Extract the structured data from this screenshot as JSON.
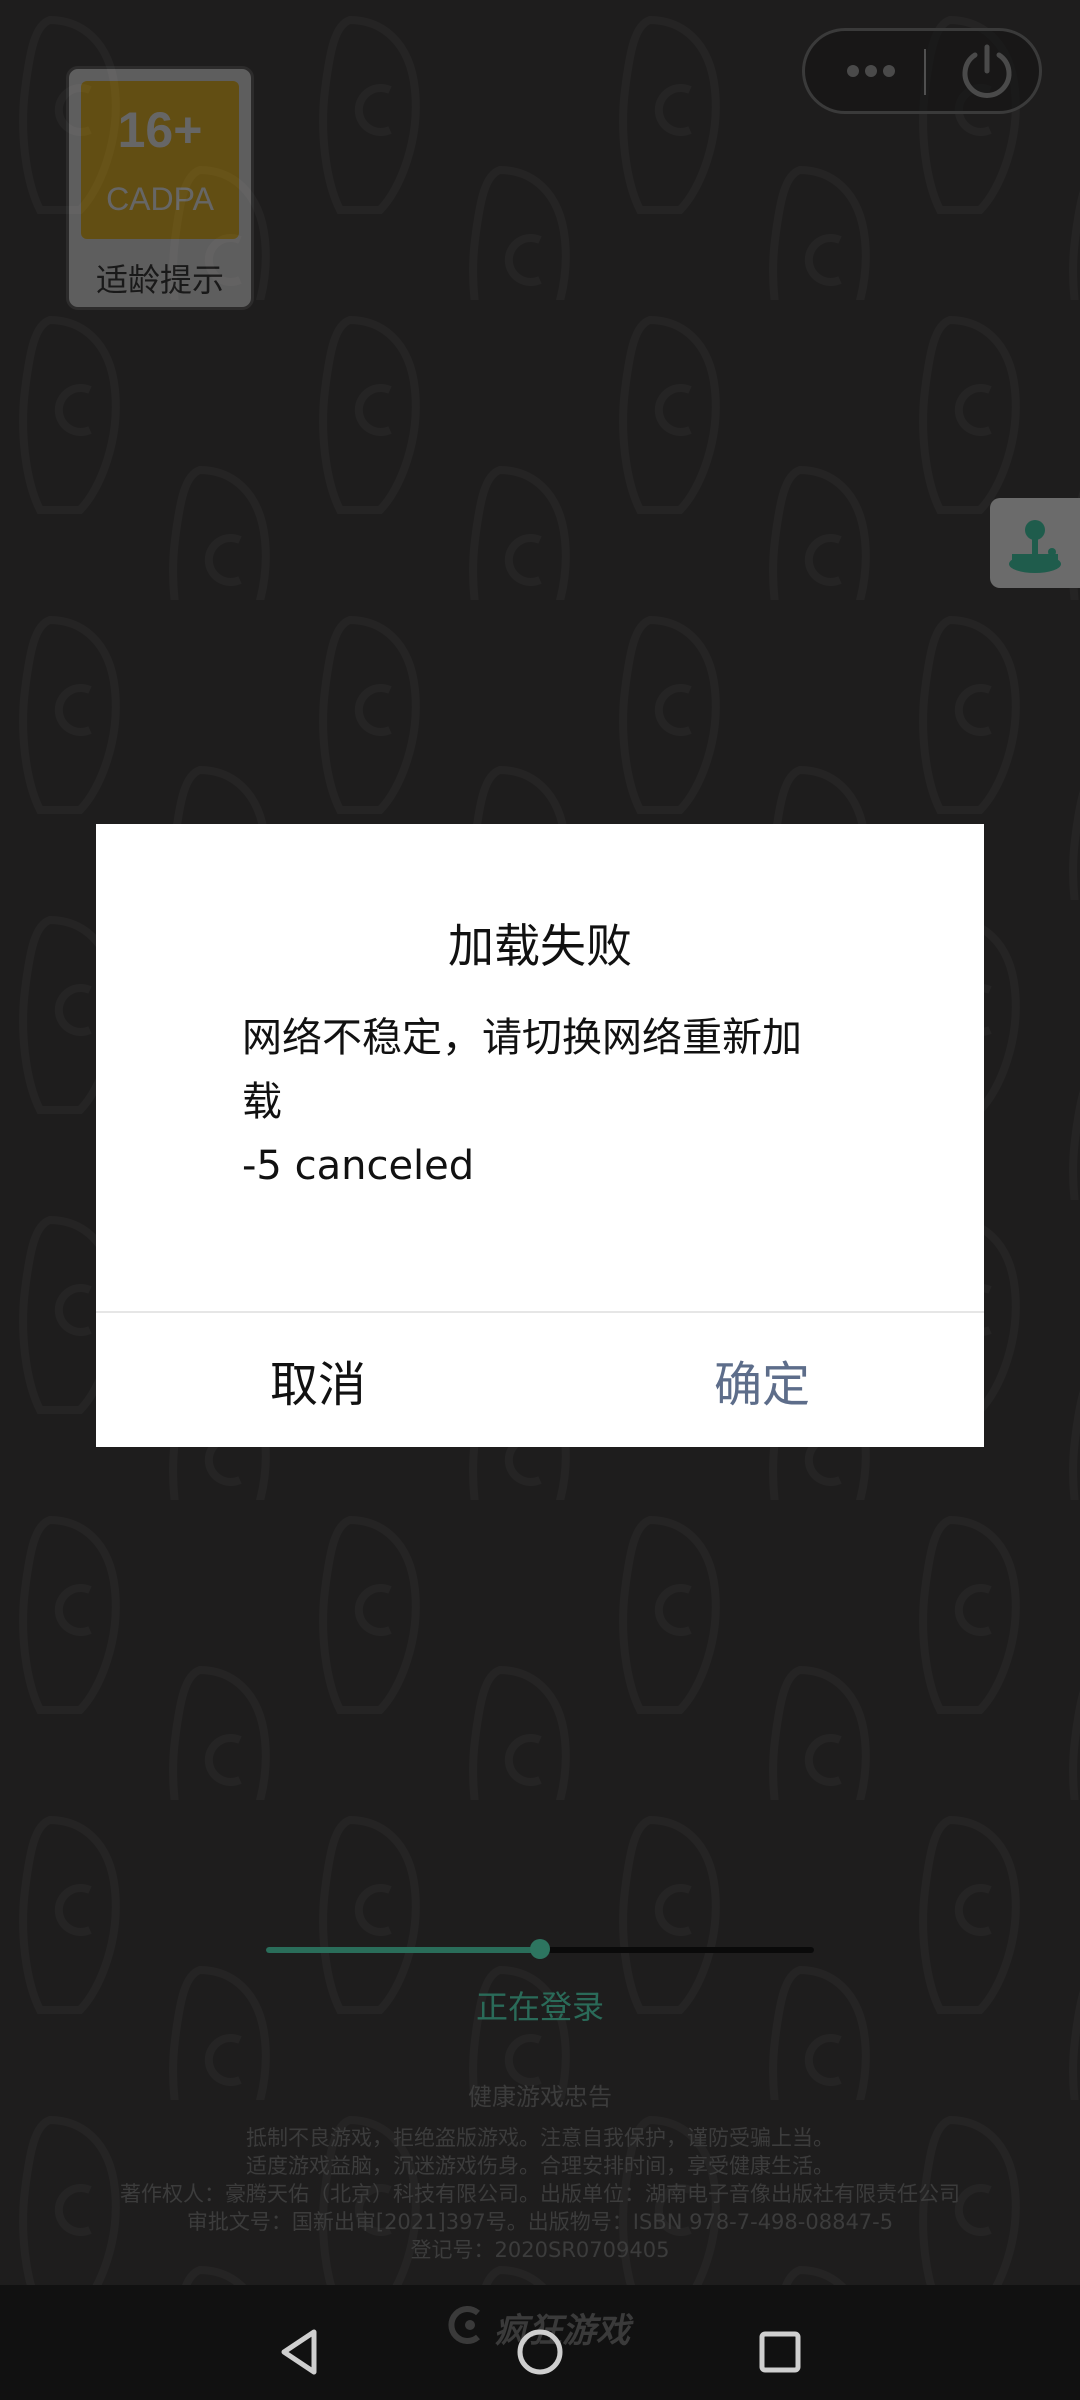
{
  "age_badge": {
    "rating": "16+",
    "org": "CADPA",
    "caption": "适龄提示"
  },
  "capsule": {
    "more_icon": "more-dots-icon",
    "power_icon": "power-icon"
  },
  "side_button": {
    "icon": "joystick-icon"
  },
  "dialog": {
    "title": "加载失败",
    "message_line1": "网络不稳定，请切换网络重新加",
    "message_line2": "载",
    "error_code": "-5 canceled",
    "cancel_label": "取消",
    "confirm_label": "确定"
  },
  "loading": {
    "progress": 0.5,
    "status": "正在登录"
  },
  "health_notice": {
    "title": "健康游戏忠告",
    "lines": [
      "抵制不良游戏，拒绝盗版游戏。注意自我保护，谨防受骗上当。",
      "适度游戏益脑，沉迷游戏伤身。合理安排时间，享受健康生活。",
      "著作权人：豪腾天佑（北京）科技有限公司。出版单位：湖南电子音像出版社有限责任公司",
      "审批文号：国新出审[2021]397号。出版物号：ISBN 978-7-498-08847-5",
      "登记号：2020SR0709405"
    ]
  },
  "nav": {
    "brand": "疯狂游戏",
    "back_icon": "back-triangle-icon",
    "home_icon": "home-circle-icon",
    "recents_icon": "recents-square-icon"
  },
  "colors": {
    "accent": "#2a6d5a",
    "confirm": "#5d6d8a",
    "badge_yellow": "#f2b600"
  }
}
